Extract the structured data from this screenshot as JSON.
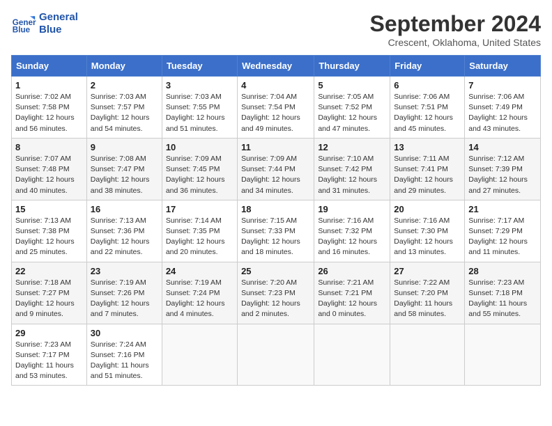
{
  "header": {
    "logo_line1": "General",
    "logo_line2": "Blue",
    "month": "September 2024",
    "location": "Crescent, Oklahoma, United States"
  },
  "weekdays": [
    "Sunday",
    "Monday",
    "Tuesday",
    "Wednesday",
    "Thursday",
    "Friday",
    "Saturday"
  ],
  "weeks": [
    [
      {
        "day": "1",
        "detail": "Sunrise: 7:02 AM\nSunset: 7:58 PM\nDaylight: 12 hours\nand 56 minutes."
      },
      {
        "day": "2",
        "detail": "Sunrise: 7:03 AM\nSunset: 7:57 PM\nDaylight: 12 hours\nand 54 minutes."
      },
      {
        "day": "3",
        "detail": "Sunrise: 7:03 AM\nSunset: 7:55 PM\nDaylight: 12 hours\nand 51 minutes."
      },
      {
        "day": "4",
        "detail": "Sunrise: 7:04 AM\nSunset: 7:54 PM\nDaylight: 12 hours\nand 49 minutes."
      },
      {
        "day": "5",
        "detail": "Sunrise: 7:05 AM\nSunset: 7:52 PM\nDaylight: 12 hours\nand 47 minutes."
      },
      {
        "day": "6",
        "detail": "Sunrise: 7:06 AM\nSunset: 7:51 PM\nDaylight: 12 hours\nand 45 minutes."
      },
      {
        "day": "7",
        "detail": "Sunrise: 7:06 AM\nSunset: 7:49 PM\nDaylight: 12 hours\nand 43 minutes."
      }
    ],
    [
      {
        "day": "8",
        "detail": "Sunrise: 7:07 AM\nSunset: 7:48 PM\nDaylight: 12 hours\nand 40 minutes."
      },
      {
        "day": "9",
        "detail": "Sunrise: 7:08 AM\nSunset: 7:47 PM\nDaylight: 12 hours\nand 38 minutes."
      },
      {
        "day": "10",
        "detail": "Sunrise: 7:09 AM\nSunset: 7:45 PM\nDaylight: 12 hours\nand 36 minutes."
      },
      {
        "day": "11",
        "detail": "Sunrise: 7:09 AM\nSunset: 7:44 PM\nDaylight: 12 hours\nand 34 minutes."
      },
      {
        "day": "12",
        "detail": "Sunrise: 7:10 AM\nSunset: 7:42 PM\nDaylight: 12 hours\nand 31 minutes."
      },
      {
        "day": "13",
        "detail": "Sunrise: 7:11 AM\nSunset: 7:41 PM\nDaylight: 12 hours\nand 29 minutes."
      },
      {
        "day": "14",
        "detail": "Sunrise: 7:12 AM\nSunset: 7:39 PM\nDaylight: 12 hours\nand 27 minutes."
      }
    ],
    [
      {
        "day": "15",
        "detail": "Sunrise: 7:13 AM\nSunset: 7:38 PM\nDaylight: 12 hours\nand 25 minutes."
      },
      {
        "day": "16",
        "detail": "Sunrise: 7:13 AM\nSunset: 7:36 PM\nDaylight: 12 hours\nand 22 minutes."
      },
      {
        "day": "17",
        "detail": "Sunrise: 7:14 AM\nSunset: 7:35 PM\nDaylight: 12 hours\nand 20 minutes."
      },
      {
        "day": "18",
        "detail": "Sunrise: 7:15 AM\nSunset: 7:33 PM\nDaylight: 12 hours\nand 18 minutes."
      },
      {
        "day": "19",
        "detail": "Sunrise: 7:16 AM\nSunset: 7:32 PM\nDaylight: 12 hours\nand 16 minutes."
      },
      {
        "day": "20",
        "detail": "Sunrise: 7:16 AM\nSunset: 7:30 PM\nDaylight: 12 hours\nand 13 minutes."
      },
      {
        "day": "21",
        "detail": "Sunrise: 7:17 AM\nSunset: 7:29 PM\nDaylight: 12 hours\nand 11 minutes."
      }
    ],
    [
      {
        "day": "22",
        "detail": "Sunrise: 7:18 AM\nSunset: 7:27 PM\nDaylight: 12 hours\nand 9 minutes."
      },
      {
        "day": "23",
        "detail": "Sunrise: 7:19 AM\nSunset: 7:26 PM\nDaylight: 12 hours\nand 7 minutes."
      },
      {
        "day": "24",
        "detail": "Sunrise: 7:19 AM\nSunset: 7:24 PM\nDaylight: 12 hours\nand 4 minutes."
      },
      {
        "day": "25",
        "detail": "Sunrise: 7:20 AM\nSunset: 7:23 PM\nDaylight: 12 hours\nand 2 minutes."
      },
      {
        "day": "26",
        "detail": "Sunrise: 7:21 AM\nSunset: 7:21 PM\nDaylight: 12 hours\nand 0 minutes."
      },
      {
        "day": "27",
        "detail": "Sunrise: 7:22 AM\nSunset: 7:20 PM\nDaylight: 11 hours\nand 58 minutes."
      },
      {
        "day": "28",
        "detail": "Sunrise: 7:23 AM\nSunset: 7:18 PM\nDaylight: 11 hours\nand 55 minutes."
      }
    ],
    [
      {
        "day": "29",
        "detail": "Sunrise: 7:23 AM\nSunset: 7:17 PM\nDaylight: 11 hours\nand 53 minutes."
      },
      {
        "day": "30",
        "detail": "Sunrise: 7:24 AM\nSunset: 7:16 PM\nDaylight: 11 hours\nand 51 minutes."
      },
      null,
      null,
      null,
      null,
      null
    ]
  ]
}
